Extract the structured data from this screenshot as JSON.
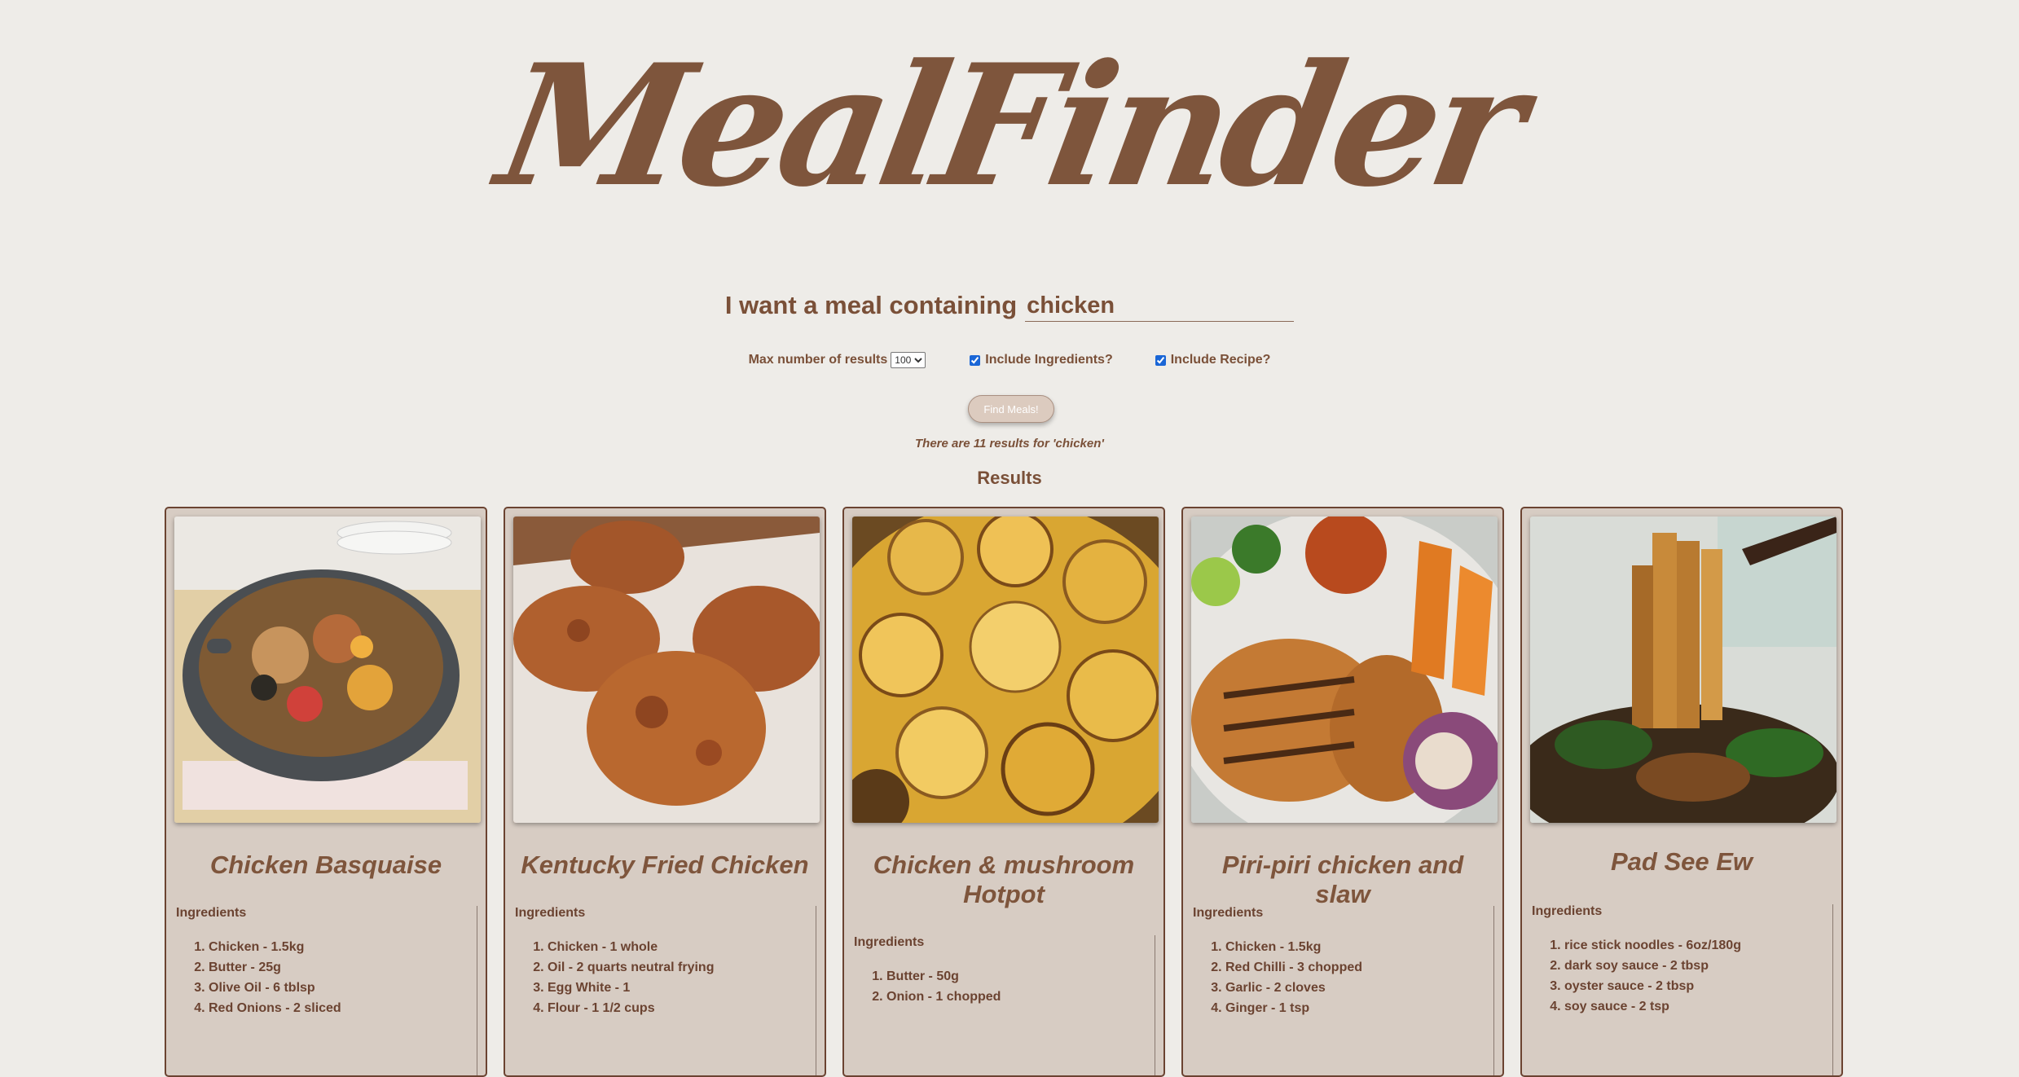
{
  "logo": {
    "text": "MealFinder"
  },
  "search": {
    "label": "I want a meal containing",
    "value": "chicken"
  },
  "options": {
    "max_label": "Max number of results",
    "max_value": "100",
    "include_ingredients_label": "Include Ingredients?",
    "include_ingredients_checked": true,
    "include_recipe_label": "Include Recipe?",
    "include_recipe_checked": true
  },
  "find_button": {
    "label": "Find Meals!"
  },
  "results": {
    "count_text": "There are 11 results for 'chicken'",
    "heading": "Results"
  },
  "colors": {
    "brand": "#7e553c",
    "card_bg": "#d7ccc3",
    "page_bg": "#eeece8",
    "card_border": "#6b4331"
  },
  "cards": [
    {
      "title": "Chicken Basquaise",
      "image_icon": "paella-pan-photo",
      "ingredients_label": "Ingredients",
      "ingredients": [
        "Chicken - 1.5kg",
        "Butter - 25g",
        "Olive Oil - 6 tblsp",
        "Red Onions - 2 sliced"
      ]
    },
    {
      "title": "Kentucky Fried Chicken",
      "image_icon": "fried-chicken-photo",
      "ingredients_label": "Ingredients",
      "ingredients": [
        "Chicken - 1 whole",
        "Oil - 2 quarts neutral frying",
        "Egg White - 1",
        "Flour - 1 1/2 cups"
      ]
    },
    {
      "title": "Chicken & mushroom Hotpot",
      "image_icon": "potato-hotpot-photo",
      "ingredients_label": "Ingredients",
      "ingredients": [
        "Butter - 50g",
        "Onion - 1 chopped"
      ]
    },
    {
      "title": "Piri-piri chicken and slaw",
      "image_icon": "grilled-chicken-photo",
      "ingredients_label": "Ingredients",
      "ingredients": [
        "Chicken - 1.5kg",
        "Red Chilli - 3 chopped",
        "Garlic - 2 cloves",
        "Ginger - 1 tsp"
      ]
    },
    {
      "title": "Pad See Ew",
      "image_icon": "noodles-photo",
      "ingredients_label": "Ingredients",
      "ingredients": [
        "rice stick noodles - 6oz/180g",
        "dark soy sauce - 2 tbsp",
        "oyster sauce - 2 tbsp",
        "soy sauce - 2 tsp"
      ]
    }
  ]
}
